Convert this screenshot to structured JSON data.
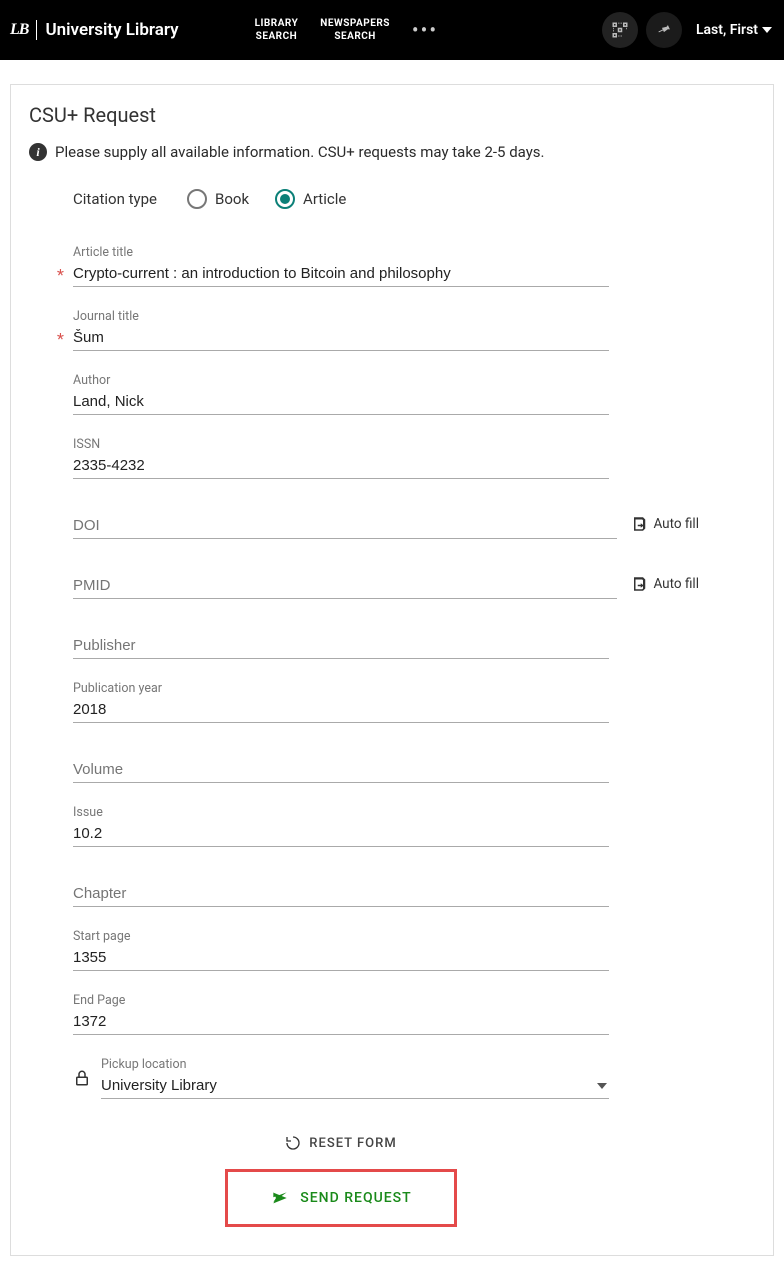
{
  "header": {
    "logo_mark": "LB",
    "logo_text": "University Library",
    "nav": {
      "library_search": "LIBRARY\nSEARCH",
      "newspapers_search": "NEWSPAPERS\nSEARCH"
    },
    "user": "Last, First"
  },
  "card": {
    "title": "CSU+ Request",
    "info": "Please supply all available information. CSU+ requests may take 2-5 days."
  },
  "citation_type": {
    "label": "Citation type",
    "options": {
      "book": "Book",
      "article": "Article"
    },
    "selected": "article"
  },
  "fields": {
    "article_title": {
      "label": "Article title",
      "value": "Crypto-current : an introduction to Bitcoin and philosophy",
      "required": true
    },
    "journal_title": {
      "label": "Journal title",
      "value": "Šum",
      "required": true
    },
    "author": {
      "label": "Author",
      "value": "Land, Nick"
    },
    "issn": {
      "label": "ISSN",
      "value": "2335-4232"
    },
    "doi": {
      "label": "DOI",
      "value": ""
    },
    "pmid": {
      "label": "PMID",
      "value": ""
    },
    "publisher": {
      "label": "Publisher",
      "value": ""
    },
    "publication_year": {
      "label": "Publication year",
      "value": "2018"
    },
    "volume": {
      "label": "Volume",
      "value": ""
    },
    "issue": {
      "label": "Issue",
      "value": "10.2"
    },
    "chapter": {
      "label": "Chapter",
      "value": ""
    },
    "start_page": {
      "label": "Start page",
      "value": "1355"
    },
    "end_page": {
      "label": "End Page",
      "value": "1372"
    },
    "pickup_location": {
      "label": "Pickup location",
      "value": "University Library"
    }
  },
  "buttons": {
    "autofill": "Auto fill",
    "reset": "RESET FORM",
    "send": "SEND REQUEST"
  }
}
